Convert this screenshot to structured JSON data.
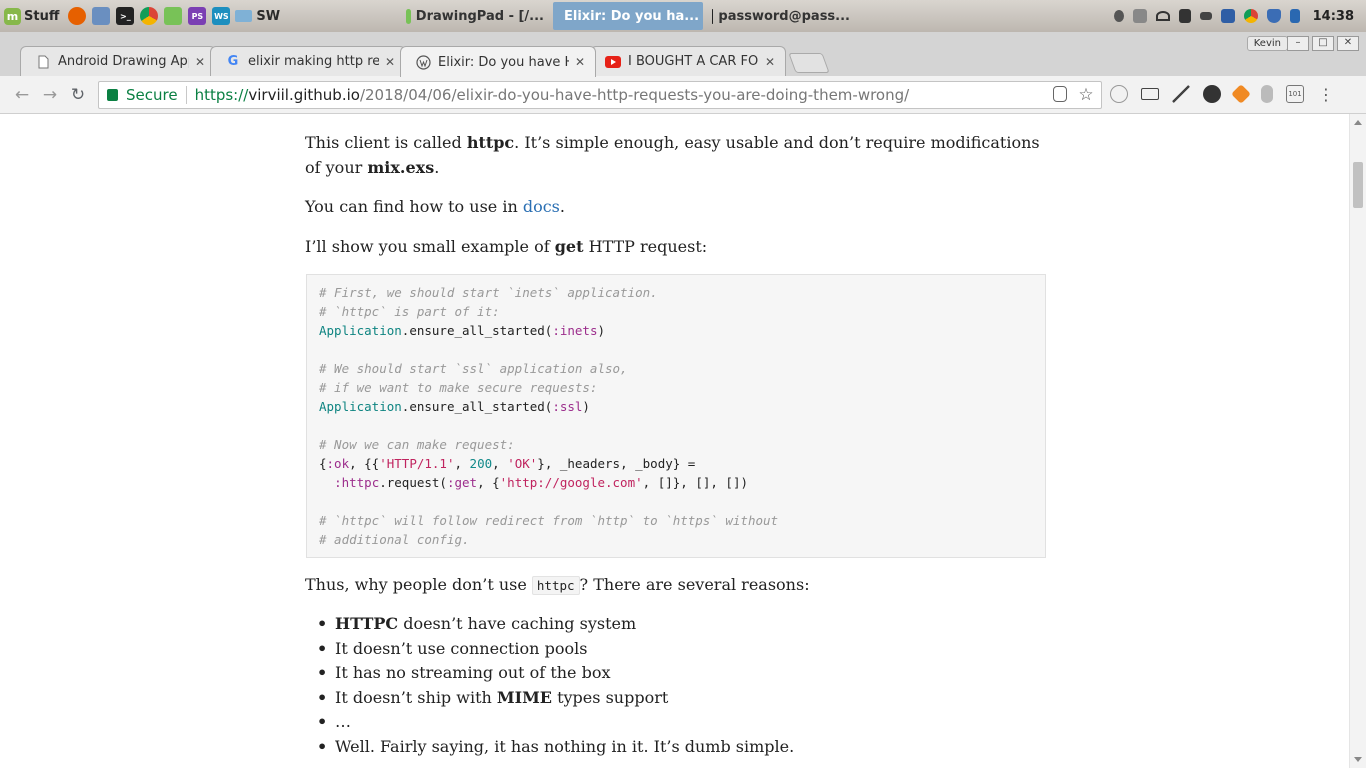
{
  "os_panel": {
    "menu_label": "Stuff",
    "folder_label": "SW",
    "tasks": [
      {
        "label": "DrawingPad - [/..."
      },
      {
        "label": "Elixir: Do you ha..."
      },
      {
        "label": "password@pass..."
      }
    ],
    "clock": "14:38"
  },
  "window": {
    "user": "Kevin"
  },
  "tabs": [
    {
      "title": "Android Drawing App T"
    },
    {
      "title": "elixir making http reque"
    },
    {
      "title": "Elixir: Do you have HTT"
    },
    {
      "title": "I BOUGHT A CAR FOR $"
    }
  ],
  "address_bar": {
    "secure_label": "Secure",
    "scheme": "https://",
    "host": "virviil.github.io",
    "path": "/2018/04/06/elixir-do-you-have-http-requests-you-are-doing-them-wrong/"
  },
  "article": {
    "p1_pre": "This client is called ",
    "p1_bold1": "httpc",
    "p1_mid": ". It’s simple enough, easy usable and don’t require modifications of your ",
    "p1_bold2": "mix.exs",
    "p1_post": ".",
    "p2_pre": "You can find how to use in ",
    "p2_link": "docs",
    "p2_post": ".",
    "p3_pre": "I’ll show you small example of ",
    "p3_bold": "get",
    "p3_post": " HTTP request:",
    "code": {
      "l1": "# First, we should start `inets` application.",
      "l2": "# `httpc` is part of it:",
      "l3_mod": "Application",
      "l3_fn": ".ensure_all_started(",
      "l3_atom": ":inets",
      "l3_end": ")",
      "l5": "# We should start `ssl` application also,",
      "l6": "# if we want to make secure requests:",
      "l7_mod": "Application",
      "l7_fn": ".ensure_all_started(",
      "l7_atom": ":ssl",
      "l7_end": ")",
      "l9": "# Now we can make request:",
      "l10_a": "{",
      "l10_ok": ":ok",
      "l10_b": ", {{",
      "l10_str1": "'HTTP/1.1'",
      "l10_c": ", ",
      "l10_num": "200",
      "l10_d": ", ",
      "l10_str2": "'OK'",
      "l10_e": "}, _headers, _body} =",
      "l11_pad": "  ",
      "l11_atom": ":httpc",
      "l11_fn": ".request(",
      "l11_get": ":get",
      "l11_b": ", {",
      "l11_str": "'http://google.com'",
      "l11_e": ", []}, [], [])",
      "l13": "# `httpc` will follow redirect from `http` to `https` without",
      "l14": "# additional config."
    },
    "p4_pre": "Thus, why people don’t use ",
    "p4_code": "httpc",
    "p4_post": "? There are several reasons:",
    "bullets": {
      "b1_bold": "HTTPC",
      "b1_rest": " doesn’t have caching system",
      "b2": "It doesn’t use connection pools",
      "b3": "It has no streaming out of the box",
      "b4_pre": "It doesn’t ship with ",
      "b4_bold": "MIME",
      "b4_post": " types support",
      "b5": "…",
      "b6": "Well. Fairly saying, it has nothing in it. It’s dumb simple."
    }
  }
}
